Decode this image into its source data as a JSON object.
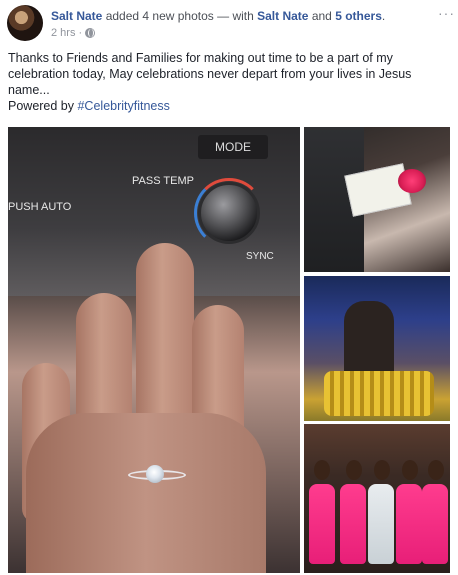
{
  "post": {
    "author": "Salt Nate",
    "action": " added 4 new photos — with ",
    "tagged_self": "Salt Nate",
    "and_text": " and ",
    "others": "5 others",
    "period": ".",
    "time": "2 hrs",
    "separator": "·",
    "privacy_icon": "globe-icon",
    "more_icon": "ellipsis-icon",
    "text_line": "Thanks to Friends and Families for making out time to be a part of my celebration today, May celebrations never depart from your lives in Jesus name...",
    "powered_label": "Powered by ",
    "hashtag": "#Celebrityfitness"
  },
  "photos": {
    "main": {
      "mode_label": "MODE",
      "pass_temp_label": "PASS TEMP",
      "push_auto_label": "PUSH AUTO",
      "sync_label": "SYNC"
    }
  },
  "colors": {
    "link": "#365899",
    "muted": "#90949c",
    "text": "#1d2129"
  }
}
